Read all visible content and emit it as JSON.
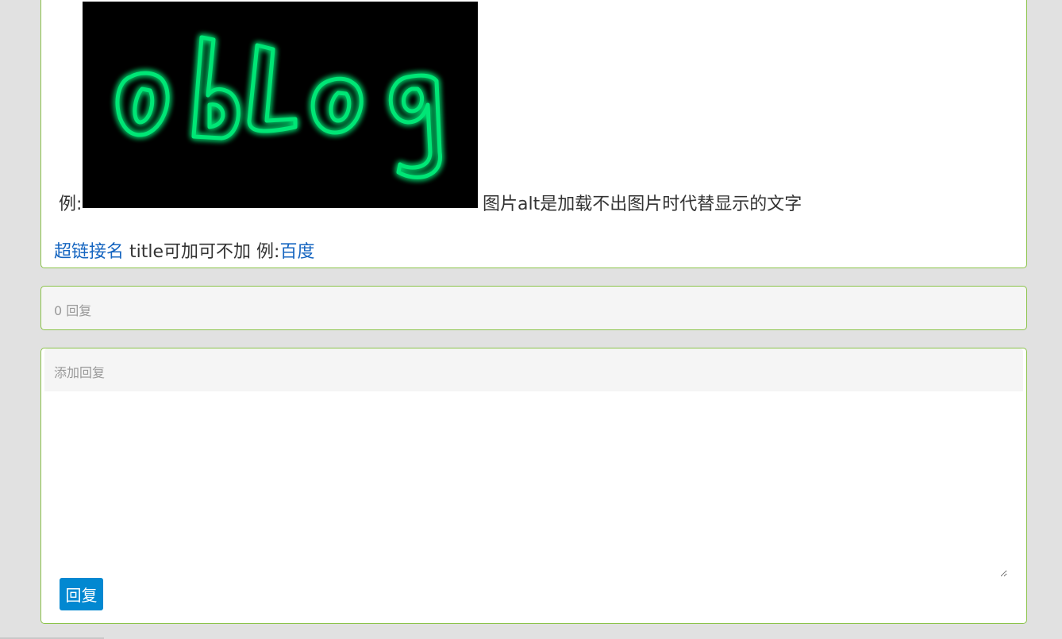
{
  "post": {
    "logo_image": {
      "text": "obLog",
      "glow_color": "#00e676",
      "background": "#000000"
    },
    "image_example_prefix": "例:",
    "image_example_desc": "图片alt是加载不出图片时代替显示的文字",
    "link_name": "超链接名",
    "link_desc": " title可加可不加 例:",
    "link_example": "百度"
  },
  "replies": {
    "count_label": "0 回复"
  },
  "reply_form": {
    "header": "添加回复",
    "textarea_value": "",
    "submit_label": "回复"
  },
  "colors": {
    "panel_border": "#8bc34a",
    "link": "#1565c0",
    "button": "#0288d1",
    "page_background": "#e1e1e1"
  }
}
